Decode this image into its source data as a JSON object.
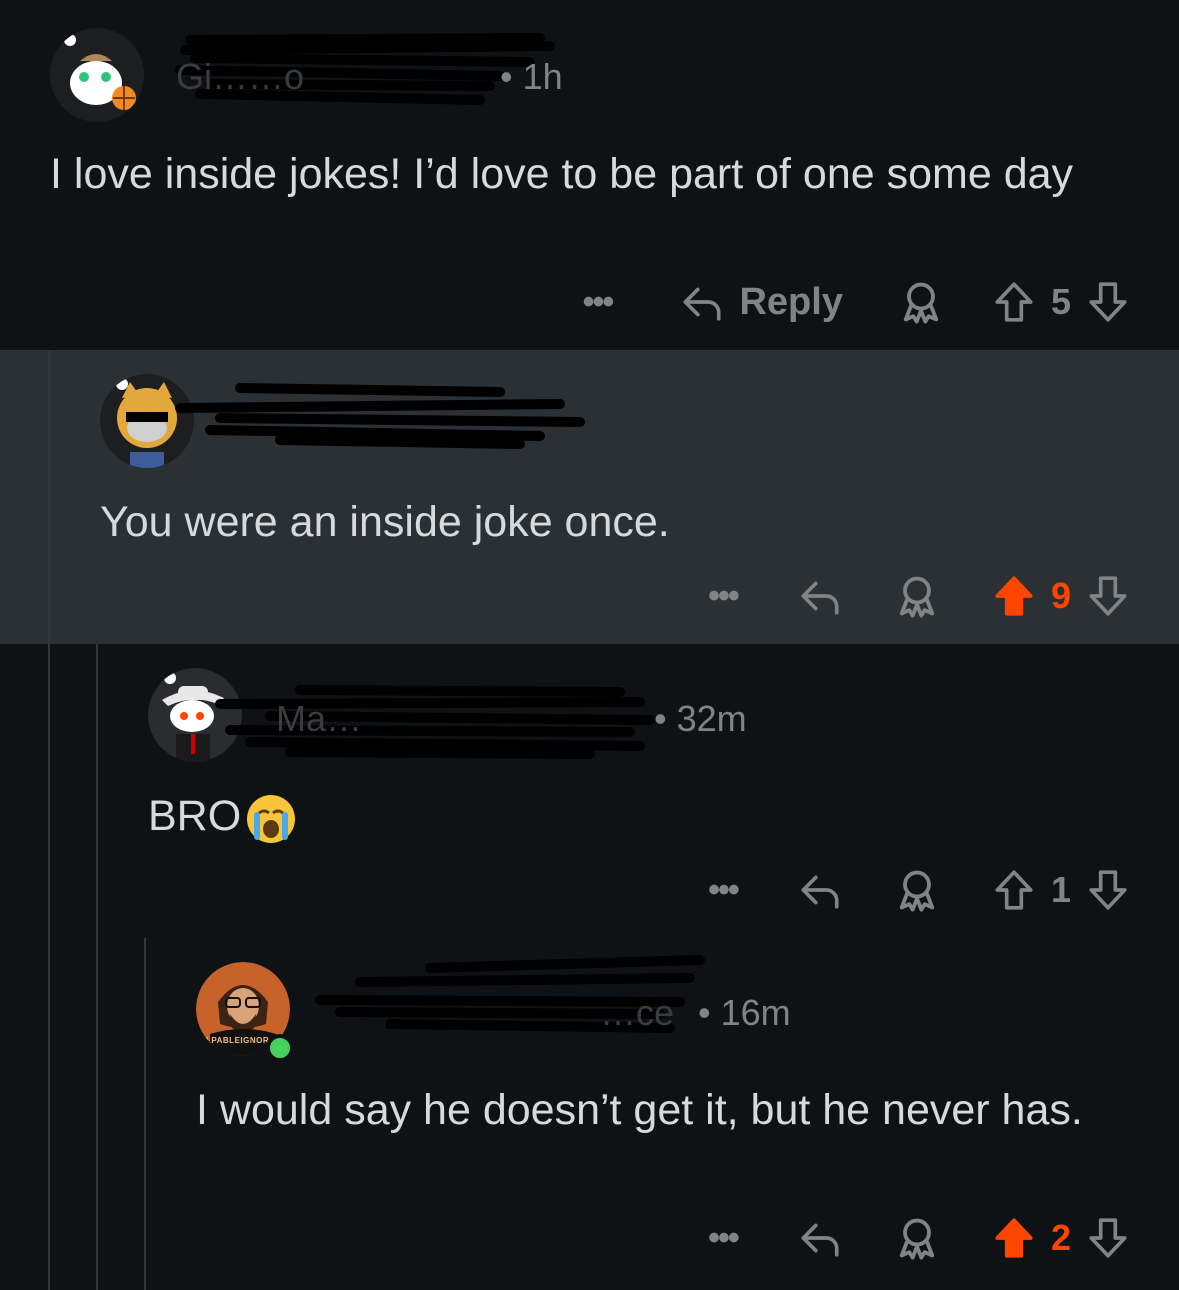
{
  "colors": {
    "background": "#0f1214",
    "highlight": "#2b3034",
    "upvoted": "#ff4500",
    "muted": "#818384",
    "text": "#d7dadc"
  },
  "comments": [
    {
      "username": "Gi……o",
      "time": "1h",
      "body": "I love inside jokes! I’d love to be part of one some day",
      "actions": {
        "more": "•••",
        "reply": "Reply",
        "score": "5",
        "voted": false
      }
    },
    {
      "username": "",
      "time": "",
      "body": "You were an inside joke once.",
      "actions": {
        "more": "•••",
        "score": "9",
        "voted": true
      }
    },
    {
      "username": "Ma…",
      "time": "32m",
      "body": "BRO",
      "emoji": "😭",
      "actions": {
        "more": "•••",
        "score": "1",
        "voted": false
      }
    },
    {
      "username": "…ce",
      "time": "16m",
      "body": "I would say he doesn’t get it, but he never has.",
      "avatar_label": "LPABLEIGNORA",
      "actions": {
        "more": "•••",
        "score": "2",
        "voted": true
      }
    }
  ],
  "icons": {
    "reply": "reply-arrow-icon",
    "award": "award-icon",
    "upvote": "upvote-arrow-icon",
    "downvote": "downvote-arrow-icon",
    "more": "more-dots-icon"
  }
}
